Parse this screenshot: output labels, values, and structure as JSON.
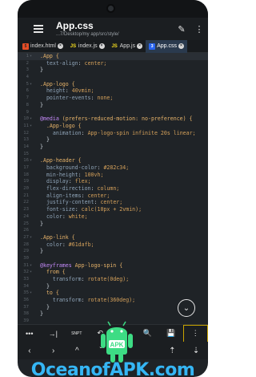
{
  "app_bar": {
    "title": "App.css",
    "subtitle": "...7/Desktop/my app/src/style/",
    "edit_icon": "pencil-icon",
    "more_icon": "more-vert-icon"
  },
  "tabs": [
    {
      "label": "index.html",
      "icon": "html-file-icon",
      "active": false
    },
    {
      "label": "index.js",
      "icon": "js-file-icon",
      "active": false
    },
    {
      "label": "App.js",
      "icon": "js-file-icon",
      "active": false
    },
    {
      "label": "App.css",
      "icon": "css-file-icon",
      "active": true
    }
  ],
  "code_lines": [
    {
      "n": "1",
      "text": ".App {"
    },
    {
      "n": "2",
      "text": "  text-align: center;"
    },
    {
      "n": "3",
      "text": "}"
    },
    {
      "n": "4",
      "text": ""
    },
    {
      "n": "5",
      "text": ".App-logo {"
    },
    {
      "n": "6",
      "text": "  height: 40vmin;"
    },
    {
      "n": "7",
      "text": "  pointer-events: none;"
    },
    {
      "n": "8",
      "text": "}"
    },
    {
      "n": "9",
      "text": ""
    },
    {
      "n": "10",
      "text": "@media (prefers-reduced-motion: no-preference) {"
    },
    {
      "n": "11",
      "text": "  .App-logo {"
    },
    {
      "n": "12",
      "text": "    animation: App-logo-spin infinite 20s linear;"
    },
    {
      "n": "13",
      "text": "  }"
    },
    {
      "n": "14",
      "text": "}"
    },
    {
      "n": "15",
      "text": ""
    },
    {
      "n": "16",
      "text": ".App-header {"
    },
    {
      "n": "17",
      "text": "  background-color: #282c34;"
    },
    {
      "n": "18",
      "text": "  min-height: 100vh;"
    },
    {
      "n": "19",
      "text": "  display: flex;"
    },
    {
      "n": "20",
      "text": "  flex-direction: column;"
    },
    {
      "n": "21",
      "text": "  align-items: center;"
    },
    {
      "n": "22",
      "text": "  justify-content: center;"
    },
    {
      "n": "23",
      "text": "  font-size: calc(10px + 2vmin);"
    },
    {
      "n": "24",
      "text": "  color: white;"
    },
    {
      "n": "25",
      "text": "}"
    },
    {
      "n": "26",
      "text": ""
    },
    {
      "n": "27",
      "text": ".App-link {"
    },
    {
      "n": "28",
      "text": "  color: #61dafb;"
    },
    {
      "n": "29",
      "text": "}"
    },
    {
      "n": "30",
      "text": ""
    },
    {
      "n": "31",
      "text": "@keyframes App-logo-spin {"
    },
    {
      "n": "32",
      "text": "  from {"
    },
    {
      "n": "33",
      "text": "    transform: rotate(0deg);"
    },
    {
      "n": "34",
      "text": "  }"
    },
    {
      "n": "35",
      "text": "  to {"
    },
    {
      "n": "36",
      "text": "    transform: rotate(360deg);"
    },
    {
      "n": "37",
      "text": "  }"
    },
    {
      "n": "38",
      "text": "}"
    },
    {
      "n": "39",
      "text": ""
    }
  ],
  "toolbar": [
    {
      "label": "•••",
      "icon": "ellipsis-icon"
    },
    {
      "label": "→|",
      "icon": "tab-icon"
    },
    {
      "label": "SNPT",
      "icon": "snippet-icon"
    },
    {
      "label": "↶",
      "icon": "undo-icon"
    },
    {
      "label": "↷",
      "icon": "redo-icon"
    },
    {
      "label": "🔍",
      "icon": "search-icon"
    },
    {
      "label": "💾",
      "icon": "save-icon"
    },
    {
      "label": "⋮",
      "icon": "more-vert-icon"
    }
  ],
  "nav_row": [
    {
      "label": "‹",
      "icon": "arrow-left-icon"
    },
    {
      "label": "›",
      "icon": "arrow-right-icon"
    },
    {
      "label": "^",
      "icon": "arrow-up-icon"
    },
    {
      "label": "ˇ",
      "icon": "arrow-down-icon"
    },
    {
      "label": "",
      "icon": "blank"
    },
    {
      "label": "",
      "icon": "blank"
    },
    {
      "label": "⇡",
      "icon": "page-up-icon"
    },
    {
      "label": "⇣",
      "icon": "page-down-icon"
    }
  ],
  "watermark": "OceanofAPK.com",
  "colors": {
    "editor_bg": "#1f2327",
    "accent_active_tab": "#2a3a4e",
    "watermark": "#35b6f5",
    "android_green": "#3ddc84"
  }
}
